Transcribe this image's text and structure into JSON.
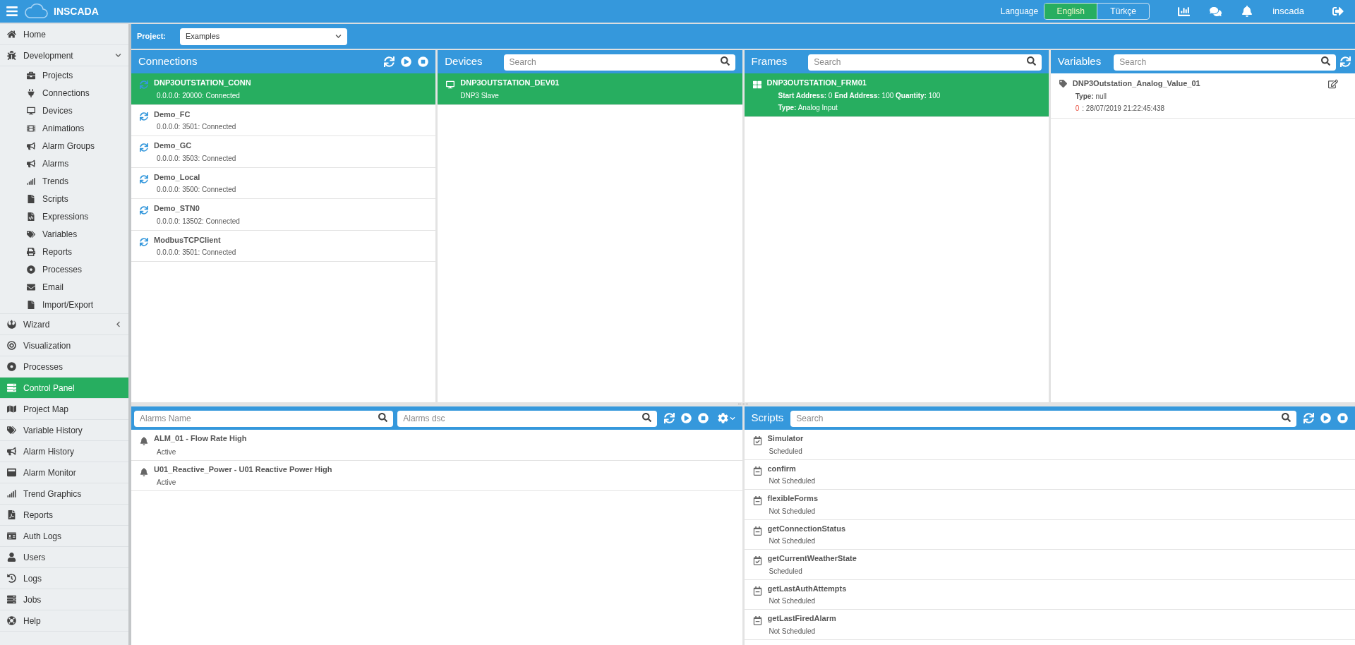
{
  "header": {
    "app_name": "INSCADA",
    "language_label": "Language",
    "languages": [
      {
        "label": "English",
        "selected": true
      },
      {
        "label": "Türkçe",
        "selected": false
      }
    ],
    "user": "inscada"
  },
  "sidebar": {
    "items": [
      {
        "label": "Home",
        "selected": false
      },
      {
        "label": "Development",
        "selected": false,
        "expanded": true,
        "children": [
          {
            "label": "Projects",
            "selected": false
          },
          {
            "label": "Connections",
            "selected": false
          },
          {
            "label": "Devices",
            "selected": false
          },
          {
            "label": "Animations",
            "selected": false
          },
          {
            "label": "Alarm Groups",
            "selected": false
          },
          {
            "label": "Alarms",
            "selected": false
          },
          {
            "label": "Trends",
            "selected": false
          },
          {
            "label": "Scripts",
            "selected": false
          },
          {
            "label": "Expressions",
            "selected": false
          },
          {
            "label": "Variables",
            "selected": false
          },
          {
            "label": "Reports",
            "selected": false
          },
          {
            "label": "Processes",
            "selected": false
          },
          {
            "label": "Email",
            "selected": false
          },
          {
            "label": "Import/Export",
            "selected": false
          }
        ]
      },
      {
        "label": "Wizard",
        "selected": false,
        "expanded": false
      },
      {
        "label": "Visualization",
        "selected": false
      },
      {
        "label": "Processes",
        "selected": false
      },
      {
        "label": "Control Panel",
        "selected": true
      },
      {
        "label": "Project Map",
        "selected": false
      },
      {
        "label": "Variable History",
        "selected": false
      },
      {
        "label": "Alarm History",
        "selected": false
      },
      {
        "label": "Alarm Monitor",
        "selected": false
      },
      {
        "label": "Trend Graphics",
        "selected": false
      },
      {
        "label": "Reports",
        "selected": false
      },
      {
        "label": "Auth Logs",
        "selected": false
      },
      {
        "label": "Users",
        "selected": false
      },
      {
        "label": "Logs",
        "selected": false
      },
      {
        "label": "Jobs",
        "selected": false
      },
      {
        "label": "Help",
        "selected": false
      }
    ]
  },
  "project_bar": {
    "label": "Project:",
    "value": "Examples"
  },
  "connections": {
    "title": "Connections",
    "items": [
      {
        "name": "DNP3OUTSTATION_CONN",
        "detail": "0.0.0.0: 20000: Connected",
        "selected": true
      },
      {
        "name": "Demo_FC",
        "detail": "0.0.0.0: 3501: Connected",
        "selected": false
      },
      {
        "name": "Demo_GC",
        "detail": "0.0.0.0: 3503: Connected",
        "selected": false
      },
      {
        "name": "Demo_Local",
        "detail": "0.0.0.0: 3500: Connected",
        "selected": false
      },
      {
        "name": "Demo_STN0",
        "detail": "0.0.0.0: 13502: Connected",
        "selected": false
      },
      {
        "name": "ModbusTCPClient",
        "detail": "0.0.0.0: 3501: Connected",
        "selected": false
      }
    ]
  },
  "devices": {
    "title": "Devices",
    "search": {
      "placeholder": "Search"
    },
    "items": [
      {
        "name": "DNP3OUTSTATION_DEV01",
        "detail": "DNP3 Slave",
        "selected": true
      }
    ]
  },
  "frames": {
    "title": "Frames",
    "search": {
      "placeholder": "Search"
    },
    "items": [
      {
        "name": "DNP3OUTSTATION_FRM01",
        "range": "**Start Address:** 0 **End Address:** 100 **Quantity:** 100",
        "type": "**Type:** Analog Input",
        "selected": true
      }
    ]
  },
  "variables": {
    "title": "Variables",
    "search": {
      "placeholder": "Search"
    },
    "items": [
      {
        "name": "DNP3Outstation_Analog_Value_01",
        "type": "**Type:** null",
        "value": "0",
        "timestamp": ": 28/07/2019 21:22:45:438"
      }
    ]
  },
  "alarms": {
    "name_search": {
      "placeholder": "Alarms Name"
    },
    "dsc_search": {
      "placeholder": "Alarms dsc"
    },
    "items": [
      {
        "name": "ALM_01 - Flow Rate High",
        "status": "Active"
      },
      {
        "name": "U01_Reactive_Power - U01 Reactive Power High",
        "status": "Active"
      }
    ]
  },
  "scripts": {
    "title": "Scripts",
    "search": {
      "placeholder": "Search"
    },
    "items": [
      {
        "name": "Simulator",
        "status": "Scheduled",
        "scheduled": true
      },
      {
        "name": "confirm",
        "status": "Not Scheduled",
        "scheduled": false
      },
      {
        "name": "flexibleForms",
        "status": "Not Scheduled",
        "scheduled": false
      },
      {
        "name": "getConnectionStatus",
        "status": "Not Scheduled",
        "scheduled": false
      },
      {
        "name": "getCurrentWeatherState",
        "status": "Scheduled",
        "scheduled": true
      },
      {
        "name": "getLastAuthAttempts",
        "status": "Not Scheduled",
        "scheduled": false
      },
      {
        "name": "getLastFiredAlarm",
        "status": "Not Scheduled",
        "scheduled": false
      }
    ]
  }
}
